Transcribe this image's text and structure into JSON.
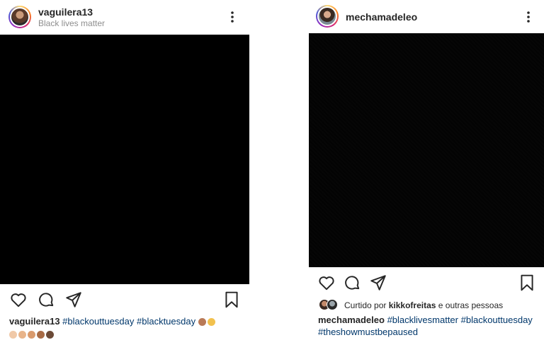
{
  "left_post": {
    "username": "vaguilera13",
    "subtitle": "Black lives matter",
    "caption": {
      "username": "vaguilera13",
      "hashtags": [
        "#blackouttuesday",
        "#blacktuesday"
      ]
    },
    "emoji_colors": [
      "#b97a57",
      "#f2c14e",
      "#e8b48a",
      "#d99a6c",
      "#a86b45",
      "#6b4a37"
    ]
  },
  "right_post": {
    "username": "mechamadeleo",
    "likes": {
      "prefix": "Curtido por",
      "user": "kikkofreitas",
      "suffix": "e outras pessoas"
    },
    "caption": {
      "username": "mechamadeleo",
      "hashtags": [
        "#blacklivesmatter",
        "#blackouttuesday",
        "#theshowmustbepaused"
      ]
    }
  },
  "icons": [
    "more-vertical-icon",
    "heart-icon",
    "comment-icon",
    "share-icon",
    "bookmark-icon"
  ]
}
